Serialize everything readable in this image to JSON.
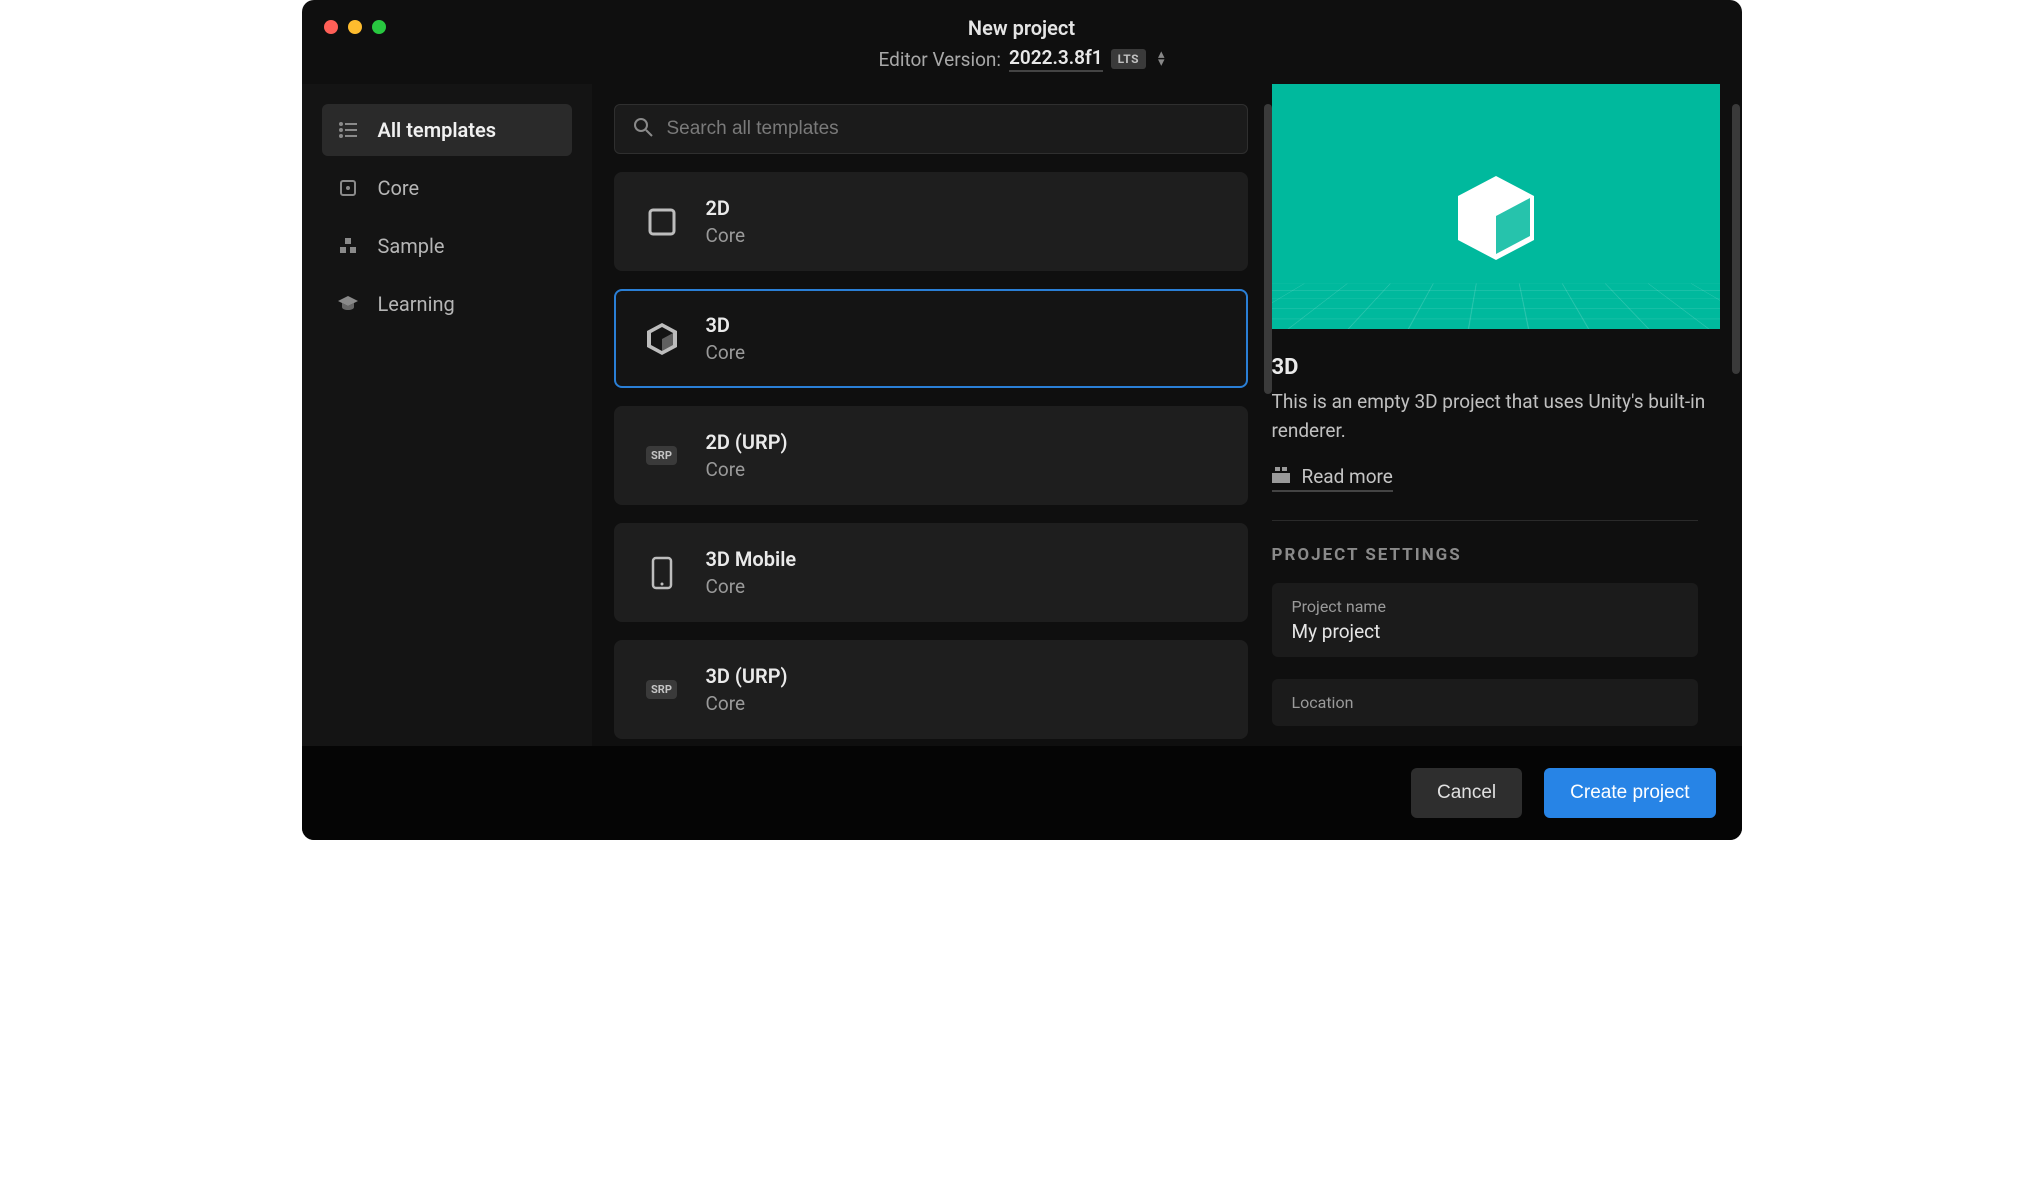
{
  "header": {
    "title": "New project",
    "editor_version_label": "Editor Version:",
    "editor_version_value": "2022.3.8f1",
    "lts_badge": "LTS"
  },
  "sidebar": {
    "items": [
      {
        "label": "All templates",
        "icon": "list-icon",
        "active": true
      },
      {
        "label": "Core",
        "icon": "square-dot-icon",
        "active": false
      },
      {
        "label": "Sample",
        "icon": "blocks-icon",
        "active": false
      },
      {
        "label": "Learning",
        "icon": "graduation-cap-icon",
        "active": false
      }
    ]
  },
  "search": {
    "placeholder": "Search all templates"
  },
  "templates": [
    {
      "name": "2D",
      "subtitle": "Core",
      "icon": "square-icon",
      "selected": false
    },
    {
      "name": "3D",
      "subtitle": "Core",
      "icon": "cube-icon",
      "selected": true
    },
    {
      "name": "2D (URP)",
      "subtitle": "Core",
      "icon": "srp-badge",
      "selected": false
    },
    {
      "name": "3D Mobile",
      "subtitle": "Core",
      "icon": "phone-icon",
      "selected": false
    },
    {
      "name": "3D (URP)",
      "subtitle": "Core",
      "icon": "srp-badge",
      "selected": false
    }
  ],
  "detail": {
    "title": "3D",
    "description": "This is an empty 3D project that uses Unity's built-in renderer.",
    "read_more_label": "Read more",
    "preview_accent": "#00b99d"
  },
  "settings": {
    "header": "PROJECT SETTINGS",
    "project_name_label": "Project name",
    "project_name_value": "My project",
    "location_label": "Location"
  },
  "footer": {
    "cancel": "Cancel",
    "create": "Create project"
  }
}
